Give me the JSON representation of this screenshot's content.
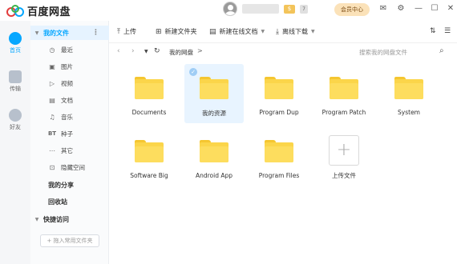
{
  "app": {
    "title": "百度网盘",
    "brand_color": "#06a7ff"
  },
  "header": {
    "vip_label": "$",
    "level_label": "7",
    "member_button": "会员中心",
    "icons": [
      "mail-icon",
      "settings-icon",
      "minimize-icon",
      "maximize-icon",
      "close-icon"
    ]
  },
  "rail": {
    "items": [
      {
        "label": "首页",
        "icon": "home-icon",
        "active": true
      },
      {
        "label": "传输",
        "icon": "transfer-icon",
        "active": false
      },
      {
        "label": "好友",
        "icon": "friends-icon",
        "active": false
      }
    ]
  },
  "sidebar": {
    "my_files": "我的文件",
    "items": [
      {
        "label": "最近",
        "icon": "clock-icon",
        "glyph": "◷"
      },
      {
        "label": "图片",
        "icon": "image-icon",
        "glyph": "▣"
      },
      {
        "label": "视频",
        "icon": "video-icon",
        "glyph": "▷"
      },
      {
        "label": "文档",
        "icon": "document-icon",
        "glyph": "▤"
      },
      {
        "label": "音乐",
        "icon": "music-icon",
        "glyph": "♫"
      },
      {
        "label": "种子",
        "icon": "bt-icon",
        "glyph": "BT"
      },
      {
        "label": "其它",
        "icon": "other-icon",
        "glyph": "⋯"
      },
      {
        "label": "隐藏空间",
        "icon": "lock-icon",
        "glyph": "⊡"
      }
    ],
    "my_share": "我的分享",
    "recycle": "回收站",
    "quick_access": "快捷访问",
    "add_quick": "+ 拖入常用文件夹"
  },
  "toolbar": {
    "upload": "上传",
    "new_folder": "新建文件夹",
    "new_online_doc": "新建在线文档",
    "offline_download": "离线下载"
  },
  "nav": {
    "breadcrumb": "我的网盘",
    "breadcrumb_sep": ">",
    "search_placeholder": "搜索我的网盘文件"
  },
  "files": [
    {
      "name": "Documents"
    },
    {
      "name": "我的资源",
      "hover": true
    },
    {
      "name": "Program Dup"
    },
    {
      "name": "Program Patch"
    },
    {
      "name": "System"
    },
    {
      "name": "Software Big"
    },
    {
      "name": "Android App"
    },
    {
      "name": "Program Files"
    }
  ],
  "upload_tile": {
    "label": "上传文件"
  }
}
